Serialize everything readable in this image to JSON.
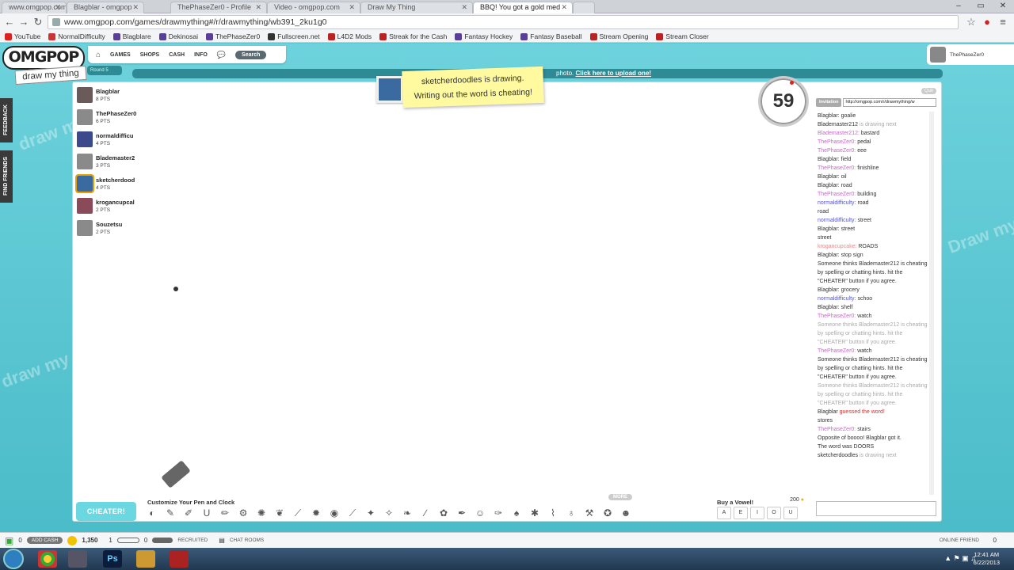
{
  "browser": {
    "tabs": [
      {
        "title": "www.omgpop.com/games",
        "active": false
      },
      {
        "title": "Blagblar - omgpop",
        "active": false
      },
      {
        "title": "ThePhaseZer0 - Profile",
        "active": false
      },
      {
        "title": "Video - omgpop.com",
        "active": false
      },
      {
        "title": "Draw My Thing",
        "active": false
      },
      {
        "title": "BBQ! You got a gold med",
        "active": true
      },
      {
        "title": "",
        "active": false
      }
    ],
    "url": "www.omgpop.com/games/drawmything#/r/drawmything/wb391_2ku1g0",
    "bookmarks": [
      {
        "label": "YouTube",
        "color": "#d22"
      },
      {
        "label": "NormalDifficulty",
        "color": "#c33"
      },
      {
        "label": "Blagblare",
        "color": "#5a3f99"
      },
      {
        "label": "Dekinosai",
        "color": "#5a3f99"
      },
      {
        "label": "ThePhaseZer0",
        "color": "#5a3f99"
      },
      {
        "label": "Fullscreen.net",
        "color": "#333"
      },
      {
        "label": "L4D2 Mods",
        "color": "#b22"
      },
      {
        "label": "Streak for the Cash",
        "color": "#b22"
      },
      {
        "label": "Fantasy Hockey",
        "color": "#5a3f99"
      },
      {
        "label": "Fantasy Baseball",
        "color": "#5a3f99"
      },
      {
        "label": "Stream Opening",
        "color": "#b22"
      },
      {
        "label": "Stream Closer",
        "color": "#b22"
      }
    ]
  },
  "site": {
    "logo": "OMGPOP",
    "tagline": "draw my thing",
    "nav": [
      "GAMES",
      "SHOPS",
      "CASH",
      "INFO"
    ],
    "search_label": "Search",
    "username": "ThePhaseZer0",
    "banner_text": "photo.",
    "banner_link": "Click here to upload one!",
    "round_label": "Round 5",
    "side_tabs": [
      "FEEDBACK",
      "FIND FRIENDS"
    ]
  },
  "players": [
    {
      "name": "Blagblar",
      "points": "8 PTS",
      "color": "#6a5a5a"
    },
    {
      "name": "ThePhaseZer0",
      "points": "6 PTS",
      "color": "#8a8a8a"
    },
    {
      "name": "normaldifficu",
      "points": "4 PTS",
      "color": "#3a4a8a"
    },
    {
      "name": "Blademaster2",
      "points": "3 PTS",
      "color": "#8a8a8a"
    },
    {
      "name": "sketcherdood",
      "points": "4 PTS",
      "color": "#3b6aa0",
      "drawing": true
    },
    {
      "name": "krogancupcal",
      "points": "2 PTS",
      "color": "#8a4a5a"
    },
    {
      "name": "Souzetsu",
      "points": "2 PTS",
      "color": "#8a8a8a"
    }
  ],
  "notice": {
    "line1": "sketcherdoodles is drawing.",
    "line2": "Writing out the word is cheating!"
  },
  "timer": "59",
  "toolbar": {
    "cheater_label": "CHEATER!",
    "customize_label": "Customize Your Pen and Clock",
    "more_label": "MORE",
    "vowel_title": "Buy a Vowel!",
    "vowel_price": "200",
    "vowels": [
      "A",
      "E",
      "I",
      "O",
      "U"
    ]
  },
  "chat": {
    "invite_label": "Invitation",
    "invite_url": "http://omgpop.com/r/drawmything/w",
    "quit_label": "Quit",
    "messages": [
      {
        "name": "Blagblar:",
        "text": "goalie"
      },
      {
        "name": "Blademaster212",
        "text": "is drawing next",
        "sys": true
      },
      {
        "name": "Blademaster212:",
        "text": "bastard",
        "nameColor": "#c6c"
      },
      {
        "name": "ThePhaseZer0:",
        "text": "pedal",
        "nameColor": "#c6c"
      },
      {
        "name": "ThePhaseZer0:",
        "text": "eee",
        "nameColor": "#c6c"
      },
      {
        "name": "Blagblar:",
        "text": "field"
      },
      {
        "name": "ThePhaseZer0:",
        "text": "finishline",
        "nameColor": "#c6c"
      },
      {
        "name": "Blagblar:",
        "text": "oil"
      },
      {
        "name": "Blagblar:",
        "text": "road"
      },
      {
        "name": "ThePhaseZer0:",
        "text": "building",
        "nameColor": "#c6c"
      },
      {
        "name": "normaldifficulty:",
        "text": "road",
        "nameColor": "#55c"
      },
      {
        "name": "",
        "text": "road"
      },
      {
        "name": "normaldifficulty:",
        "text": "street",
        "nameColor": "#55c"
      },
      {
        "name": "Blagblar:",
        "text": "street"
      },
      {
        "name": "",
        "text": "street"
      },
      {
        "name": "krogancupcake:",
        "text": "ROADS",
        "nameColor": "#e88"
      },
      {
        "name": "Blagblar:",
        "text": "stop sign"
      },
      {
        "name": "",
        "text": "Someone thinks Blademaster212 is cheating by spelling or chatting hints. hit the \"CHEATER\" button if you agree."
      },
      {
        "name": "Blagblar:",
        "text": "grocery"
      },
      {
        "name": "normaldifficulty:",
        "text": "schoo",
        "nameColor": "#55c"
      },
      {
        "name": "Blagblar:",
        "text": "shelf"
      },
      {
        "name": "ThePhaseZer0:",
        "text": "watch",
        "nameColor": "#c6c"
      },
      {
        "name": "",
        "text": "Someone thinks Blademaster212 is cheating by spelling or chatting hints. hit the \"CHEATER\" button if you agree.",
        "sys": true
      },
      {
        "name": "ThePhaseZer0:",
        "text": "watch",
        "nameColor": "#c6c"
      },
      {
        "name": "",
        "text": "Someone thinks Blademaster212 is cheating by spelling or chatting hints. hit the \"CHEATER\" button if you agree."
      },
      {
        "name": "",
        "text": "Someone thinks Blademaster212 is cheating by spelling or chatting hints. hit the \"CHEATER\" button if you agree.",
        "sys": true
      },
      {
        "name": "Blagblar",
        "text": "guessed the word!",
        "guess": true
      },
      {
        "name": "",
        "text": "stores"
      },
      {
        "name": "ThePhaseZer0:",
        "text": "stairs",
        "nameColor": "#c6c"
      },
      {
        "name": "",
        "text": "Opposite of boooo! Blagblar got it."
      },
      {
        "name": "",
        "text": "The word was DOORS"
      },
      {
        "name": "sketcherdoodles",
        "text": "is drawing next",
        "sys": true
      }
    ]
  },
  "status": {
    "add_cash": "ADD CASH",
    "coins": "1,350",
    "level": "1",
    "score": "0",
    "recruited": "RECRUITED",
    "chat_rooms": "CHAT ROOMS",
    "online_friends": "ONLINE FRIEND",
    "zero": "0"
  },
  "taskbar": {
    "time": "12:41 AM",
    "date": "6/22/2013"
  },
  "accent": "#5bc8d4"
}
